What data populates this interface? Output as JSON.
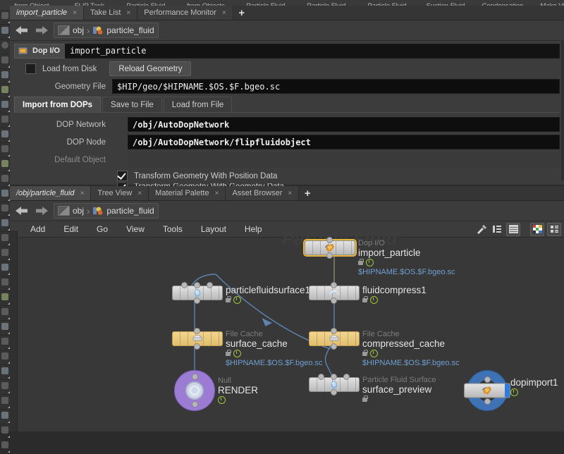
{
  "shelf": {
    "row_top": [
      "from Object",
      "FLIP Tank",
      "Particle Fluid",
      "from Objects",
      "Particle Fluid",
      "Particle Fluid",
      "Particle Fluid",
      "Suction Fluid",
      "Condensation",
      "Make Viscous"
    ]
  },
  "params_panel": {
    "tabs": [
      {
        "label": "import_particle",
        "active": true,
        "close": "×"
      },
      {
        "label": "Take List",
        "active": false,
        "close": "×"
      },
      {
        "label": "Performance Monitor",
        "active": false,
        "close": "×"
      }
    ],
    "add_tab": "+",
    "breadcrumb": {
      "root": "obj",
      "node": "particle_fluid"
    },
    "node_header": {
      "type_label": "Dop I/O",
      "name": "import_particle"
    },
    "load_from_disk": {
      "label": "Load from Disk",
      "checked": false
    },
    "reload_button": "Reload Geometry",
    "geometry_file": {
      "label": "Geometry File",
      "value": "$HIP/geo/$HIPNAME.$OS.$F.bgeo.sc"
    },
    "subtabs": [
      {
        "label": "Import from DOPs",
        "active": true
      },
      {
        "label": "Save to File",
        "active": false
      },
      {
        "label": "Load from File",
        "active": false
      }
    ],
    "dop_network": {
      "label": "DOP Network",
      "value": "/obj/AutoDopNetwork"
    },
    "dop_node": {
      "label": "DOP Node",
      "value": "/obj/AutoDopNetwork/flipfluidobject"
    },
    "default_object": {
      "label": "Default Object",
      "value": ""
    },
    "checkboxes": [
      {
        "label": "Transform Geometry With Position Data",
        "checked": true
      },
      {
        "label": "Transform Geometry With Geometry Data",
        "checked": true
      }
    ]
  },
  "network_panel": {
    "tabs": [
      {
        "label": "/obj/particle_fluid",
        "active": true,
        "close": "×"
      },
      {
        "label": "Tree View",
        "active": false,
        "close": "×"
      },
      {
        "label": "Material Palette",
        "active": false,
        "close": "×"
      },
      {
        "label": "Asset Browser",
        "active": false,
        "close": "×"
      }
    ],
    "add_tab": "+",
    "breadcrumb": {
      "root": "obj",
      "node": "particle_fluid"
    },
    "menu": [
      "Add",
      "Edit",
      "Go",
      "View",
      "Tools",
      "Layout",
      "Help"
    ],
    "toolbar_icons": [
      "tools-icon",
      "list-icon",
      "spreadsheet-icon",
      "color-palette-icon",
      "layout-grid-icon"
    ],
    "watermark": "Particle Fluid"
  },
  "nodes": [
    {
      "id": "import_particle",
      "type": "Dop I/O",
      "name": "import_particle",
      "cache": "$HIPNAME.$OS.$F.bgeo.sc",
      "selected": true,
      "style": "flat",
      "color": "#e3e3e3",
      "glyph": "dop-io-icon",
      "locked": true,
      "bypass_flag": true
    },
    {
      "id": "particlefluidsurface1",
      "type": "",
      "name": "particlefluidsurface1",
      "cache": "",
      "selected": false,
      "style": "flat",
      "color": "#e3e3e3",
      "glyph": "particle-fluid-surface-icon",
      "locked": true,
      "bypass_flag": true
    },
    {
      "id": "fluidcompress1",
      "type": "",
      "name": "fluidcompress1",
      "cache": "",
      "selected": false,
      "style": "flat",
      "color": "#e3e3e3",
      "glyph": "fluid-compress-icon",
      "locked": true,
      "bypass_flag": true
    },
    {
      "id": "surface_cache",
      "type": "File Cache",
      "name": "surface_cache",
      "cache": "$HIPNAME.$OS.$F.bgeo.sc",
      "selected": false,
      "style": "yellow",
      "color": "#e3bf6c",
      "glyph": "file-cache-icon",
      "locked": true,
      "bypass_flag": true
    },
    {
      "id": "compressed_cache",
      "type": "File Cache",
      "name": "compressed_cache",
      "cache": "$HIPNAME.$OS.$F.bgeo.sc",
      "selected": false,
      "style": "yellow",
      "color": "#e3bf6c",
      "glyph": "file-cache-icon",
      "locked": true,
      "bypass_flag": true
    },
    {
      "id": "RENDER",
      "type": "Null",
      "name": "RENDER",
      "cache": "",
      "selected": false,
      "style": "circle-purple",
      "color": "#9b7bd4",
      "glyph": "null-icon",
      "locked": false,
      "bypass_flag": true
    },
    {
      "id": "surface_preview",
      "type": "Particle Fluid Surface",
      "name": "surface_preview",
      "cache": "",
      "selected": false,
      "style": "flat",
      "color": "#e3e3e3",
      "glyph": "particle-fluid-surface-icon",
      "locked": true,
      "bypass_flag": false
    },
    {
      "id": "dopimport1",
      "type": "",
      "name": "dopimport1",
      "cache": "",
      "selected": false,
      "style": "circle-blue",
      "color": "#3f72b5",
      "glyph": "dop-import-icon",
      "locked": false,
      "bypass_flag": true
    }
  ],
  "colors": {
    "accent_selected": "#e9b63c",
    "cache_text": "#6f9fd0",
    "flag_green": "#9ec63b",
    "panel_bg": "#3c3c3c",
    "canvas_bg": "#333333",
    "field_bg": "#0e0e0e"
  }
}
